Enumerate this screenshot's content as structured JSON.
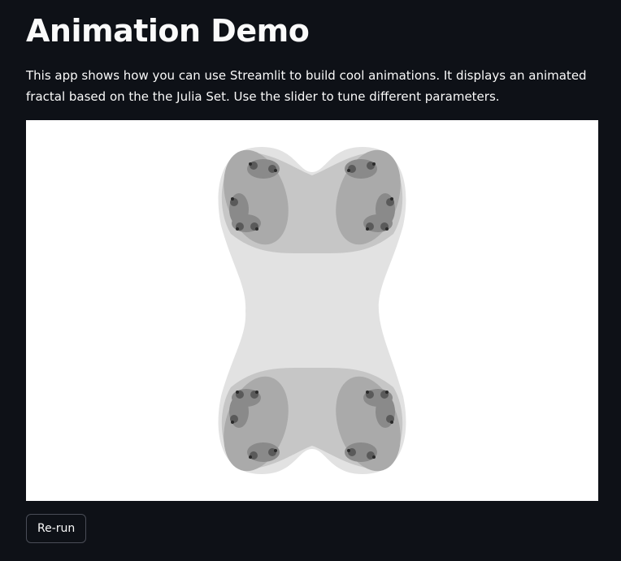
{
  "page": {
    "title": "Animation Demo",
    "description": "This app shows how you can use Streamlit to build cool animations. It displays an animated fractal based on the the Julia Set. Use the slider to tune different parameters."
  },
  "fractal": {
    "colors": {
      "background": "#ffffff",
      "level1": "#e2e2e2",
      "level2": "#c6c6c6",
      "level3": "#aaaaaa",
      "level4": "#8a8a8a",
      "level5": "#5a5a5a",
      "level6": "#2a2a2a"
    }
  },
  "controls": {
    "rerun_label": "Re-run"
  }
}
